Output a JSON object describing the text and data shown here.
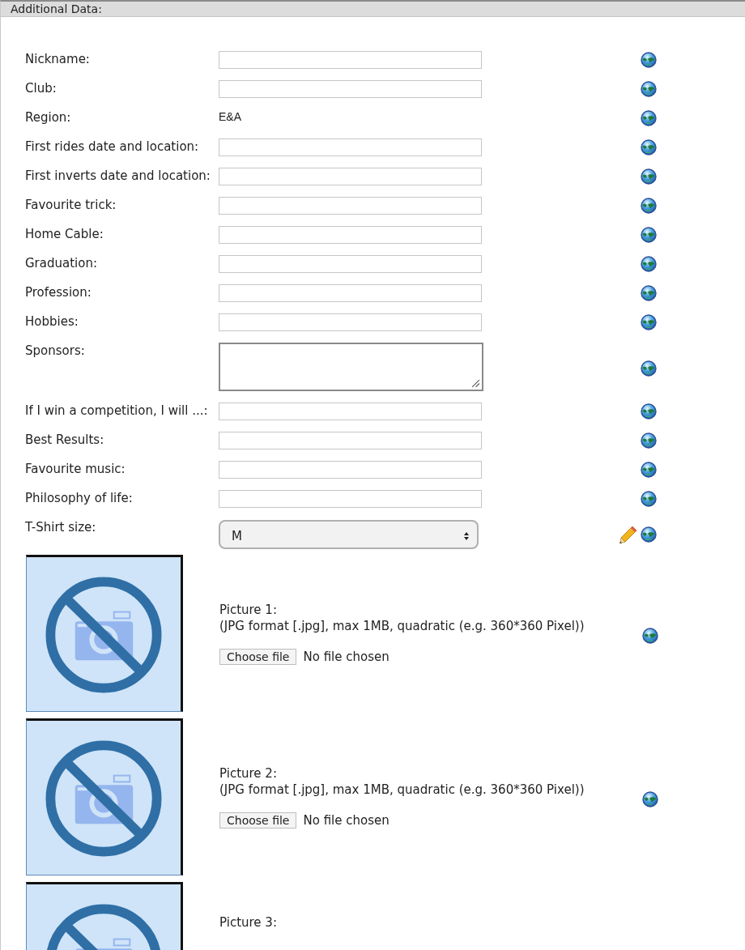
{
  "section": {
    "title": "Additional Data:"
  },
  "fields": [
    {
      "kind": "text",
      "label": "Nickname:"
    },
    {
      "kind": "text",
      "label": "Club:"
    },
    {
      "kind": "static",
      "label": "Region:",
      "value": "E&A"
    },
    {
      "kind": "text",
      "label": "First rides date and location:"
    },
    {
      "kind": "text",
      "label": "First inverts date and location:"
    },
    {
      "kind": "text",
      "label": "Favourite trick:"
    },
    {
      "kind": "text",
      "label": "Home Cable:"
    },
    {
      "kind": "text",
      "label": "Graduation:"
    },
    {
      "kind": "text",
      "label": "Profession:"
    },
    {
      "kind": "text",
      "label": "Hobbies:"
    },
    {
      "kind": "textarea",
      "label": "Sponsors:"
    },
    {
      "kind": "text",
      "label": "If I win a competition, I will ...:"
    },
    {
      "kind": "text",
      "label": "Best Results:"
    },
    {
      "kind": "text",
      "label": "Favourite music:"
    },
    {
      "kind": "text",
      "label": "Philosophy of life:"
    },
    {
      "kind": "select",
      "label": "T-Shirt size:",
      "value": "M"
    }
  ],
  "pictures": [
    {
      "label": "Picture 1:",
      "note": "(JPG format [.jpg], max 1MB, quadratic (e.g. 360*360 Pixel))",
      "button": "Choose file",
      "status": "No file chosen"
    },
    {
      "label": "Picture 2:",
      "note": "(JPG format [.jpg], max 1MB, quadratic (e.g. 360*360 Pixel))",
      "button": "Choose file",
      "status": "No file chosen"
    },
    {
      "label": "Picture 3:"
    }
  ]
}
